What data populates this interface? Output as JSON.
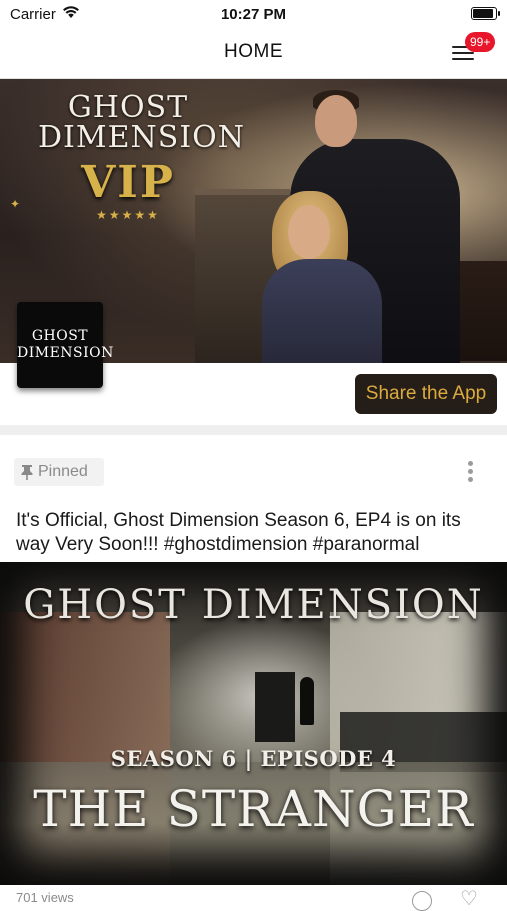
{
  "status_bar": {
    "carrier": "Carrier",
    "time": "10:27 PM"
  },
  "nav": {
    "title": "HOME",
    "badge_count": "99+",
    "badge_color": "#e8162a"
  },
  "hero": {
    "title_line1": "GHOST",
    "title_line2": "DIMENSION",
    "vip": "VIP",
    "stars": "★★★★★",
    "logo_line1": "GHOST",
    "logo_line2": "DIMENSION",
    "share_label": "Share the App",
    "share_text_color": "#dcab3e"
  },
  "post": {
    "pinned_label": "Pinned",
    "text": "It's Official, Ghost Dimension Season 6, EP4 is on its way Very Soon!!! #ghostdimension #paranormal",
    "image": {
      "title": "GHOST DIMENSION",
      "episode": "SEASON 6 | EPISODE 4",
      "subtitle": "THE STRANGER"
    },
    "views_text": "701 views"
  },
  "icons": {
    "wifi": "wifi-icon",
    "battery": "battery-icon",
    "menu": "menu-icon",
    "pin": "pin-icon",
    "more": "more-vertical-icon",
    "comment": "comment-icon",
    "like": "heart-icon"
  }
}
